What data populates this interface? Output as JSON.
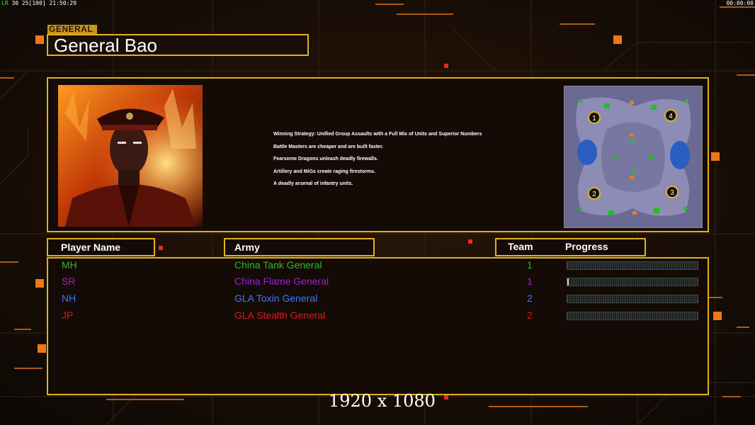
{
  "hud": {
    "left": "30 25[100] 21:50:29",
    "left_prefix": "LR",
    "right": "00:00:00"
  },
  "header": {
    "tag": "GENERAL",
    "title": "General Bao"
  },
  "strategy": [
    "Winning Strategy: Unified Group Assaults with a Full Mix of Units and Superior Numbers",
    "Battle Masters are cheaper and are built faster.",
    "Fearsome Dragons unleash deadly firewalls.",
    "Artillery and MiGs create raging firestorms.",
    "A deadly arsenal of infantry units."
  ],
  "map": {
    "start_positions": [
      "1",
      "2",
      "3",
      "4"
    ]
  },
  "columns": {
    "player": "Player Name",
    "army": "Army",
    "team": "Team",
    "progress": "Progress"
  },
  "players": [
    {
      "name": "MH",
      "army": "China Tank General",
      "team": "1",
      "color": "#2db82d",
      "progress": 0.0
    },
    {
      "name": "SR",
      "army": "China Flame General",
      "team": "1",
      "color": "#a020d0",
      "progress": 0.01
    },
    {
      "name": "NH",
      "army": "GLA Toxin General",
      "team": "2",
      "color": "#3a78ff",
      "progress": 0.0
    },
    {
      "name": "JP",
      "army": "GLA Stealth General",
      "team": "2",
      "color": "#e01818",
      "progress": 0.0
    }
  ],
  "resolution": "1920 x 1080",
  "colors": {
    "accent": "#e0b020",
    "tag_bg": "#c8961e",
    "background": "#120c08"
  }
}
